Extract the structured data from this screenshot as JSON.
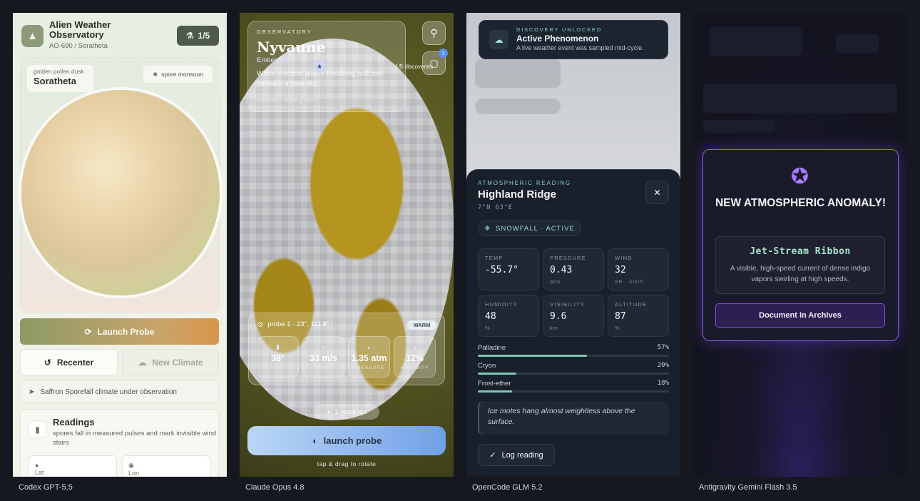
{
  "captions": [
    "Codex GPT-5.5",
    "Claude Opus 4.8",
    "OpenCode GLM 5.2",
    "Antigravity Gemini Flash 3.5"
  ],
  "p1": {
    "title": "Alien Weather Observatory",
    "subtitle": "AO-690 / Soratheta",
    "counter": "1/5",
    "planet_tag_small": "golden pollen dusk",
    "planet_tag_name": "Soratheta",
    "weather_tag": "spore monsoon",
    "launch": "Launch Probe",
    "recenter": "Recenter",
    "new_climate": "New Climate",
    "status": "Saffron Sporefall climate under observation",
    "readings_title": "Readings",
    "readings_desc": "spores fall in measured pulses and mark invisible wind stairs",
    "cell_lat": "Lat",
    "cell_lon": "Lon"
  },
  "p2": {
    "kicker": "OBSERVATORY",
    "name": "Nyvaune",
    "sub": "Emberwild",
    "desc": "Warm volcanic plains breathing soft ash beneath a rose sky.",
    "weather": "weather · drifting ash",
    "discoveries": "1/5 discoveries",
    "badge": "1",
    "probe_label": "probe 1 · 23°, 111.8°",
    "warm": "WARM",
    "stats": [
      {
        "value": "38°",
        "label": "TEMP"
      },
      {
        "value": "33 m/s",
        "label": "WIND"
      },
      {
        "value": "1.35 atm",
        "label": "PRESSURE"
      },
      {
        "value": "12%",
        "label": "HUMIDITY"
      }
    ],
    "readings": "1 readings",
    "launch": "launch probe",
    "hint": "tap & drag to rotate"
  },
  "p3": {
    "toast_kicker": "DISCOVERY UNLOCKED",
    "toast_title": "Active Phenomenon",
    "toast_sub": "A live weather event was sampled mid-cycle.",
    "kicker": "ATMOSPHERIC READING",
    "location": "Highland Ridge",
    "coords": "7°N 63°E",
    "chip": "SNOWFALL · ACTIVE",
    "cards": [
      {
        "k": "TEMP",
        "v": "-55.7°",
        "u": ""
      },
      {
        "k": "PRESSURE",
        "v": "0.43",
        "u": "atm"
      },
      {
        "k": "WIND",
        "v": "32",
        "u": "SE · km/h"
      },
      {
        "k": "HUMIDITY",
        "v": "48",
        "u": "%"
      },
      {
        "k": "VISIBILITY",
        "v": "9.6",
        "u": "km"
      },
      {
        "k": "ALTITUDE",
        "v": "87",
        "u": "%"
      }
    ],
    "bars": [
      {
        "label": "Palladine",
        "pct": "57%",
        "value": 0.57
      },
      {
        "label": "Cryon",
        "pct": "20%",
        "value": 0.2
      },
      {
        "label": "Frost-ether",
        "pct": "18%",
        "value": 0.18
      }
    ],
    "quote": "Ice motes hang almost weightless above the surface.",
    "log": "Log reading"
  },
  "p4": {
    "headline": "NEW ATMOSPHERIC ANOMALY!",
    "phenomenon": "Jet-Stream Ribbon",
    "description": "A visible, high-speed current of dense indigo vapors swirling at high speeds.",
    "button": "Document in Archives"
  },
  "colors": {
    "p1_accent": "#d9954a",
    "p2_button": "#8fb6ec",
    "p3_accent": "#8fd5c0",
    "p4_accent": "#8b5cf6"
  }
}
